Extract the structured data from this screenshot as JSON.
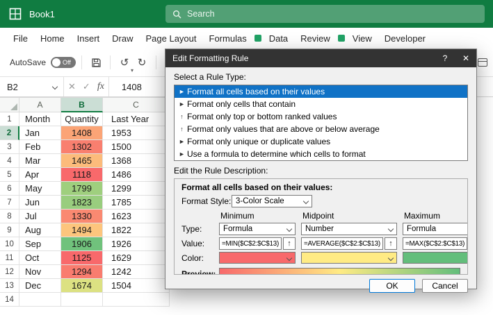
{
  "titlebar": {
    "title": "Book1",
    "search_placeholder": "Search"
  },
  "menu": {
    "items": [
      "File",
      "Home",
      "Insert",
      "Draw",
      "Page Layout",
      "Formulas",
      "Data",
      "Review",
      "View",
      "Developer"
    ]
  },
  "toolbar": {
    "autosave_label": "AutoSave",
    "autosave_state": "Off",
    "undo_glyph": "↺",
    "redo_glyph": "↻"
  },
  "formula_bar": {
    "name_box": "B2",
    "cancel_glyph": "✕",
    "enter_glyph": "✓",
    "fx_label": "fx",
    "value": "1408"
  },
  "grid": {
    "col_headers": [
      "A",
      "B",
      "C"
    ],
    "rows": [
      {
        "n": 1,
        "a": "Month",
        "b": "Quantity",
        "c": "Last Year"
      },
      {
        "n": 2,
        "a": "Jan",
        "b": "1408",
        "c": "1953",
        "b_color": "#FBA476"
      },
      {
        "n": 3,
        "a": "Feb",
        "b": "1302",
        "c": "1500",
        "b_color": "#F97F6F"
      },
      {
        "n": 4,
        "a": "Mar",
        "b": "1465",
        "c": "1368",
        "b_color": "#FCBB7B"
      },
      {
        "n": 5,
        "a": "Apr",
        "b": "1118",
        "c": "1486",
        "b_color": "#F8696B"
      },
      {
        "n": 6,
        "a": "May",
        "b": "1799",
        "c": "1299",
        "b_color": "#9FCF7E"
      },
      {
        "n": 7,
        "a": "Jun",
        "b": "1823",
        "c": "1785",
        "b_color": "#99CD7E"
      },
      {
        "n": 8,
        "a": "Jul",
        "b": "1330",
        "c": "1623",
        "b_color": "#FA8971"
      },
      {
        "n": 9,
        "a": "Aug",
        "b": "1494",
        "c": "1822",
        "b_color": "#FDC57D"
      },
      {
        "n": 10,
        "a": "Sep",
        "b": "1906",
        "c": "1926",
        "b_color": "#70C27C"
      },
      {
        "n": 11,
        "a": "Oct",
        "b": "1125",
        "c": "1629",
        "b_color": "#F8696B"
      },
      {
        "n": 12,
        "a": "Nov",
        "b": "1294",
        "c": "1242",
        "b_color": "#F97C6F"
      },
      {
        "n": 13,
        "a": "Dec",
        "b": "1674",
        "c": "1504",
        "b_color": "#DCE182"
      },
      {
        "n": 14,
        "a": "",
        "b": "",
        "c": ""
      }
    ]
  },
  "dialog": {
    "title": "Edit Formatting Rule",
    "help_glyph": "?",
    "close_glyph": "✕",
    "select_rule_label": "Select a Rule Type:",
    "rule_types": [
      {
        "icon": "►",
        "label": "Format all cells based on their values"
      },
      {
        "icon": "►",
        "label": "Format only cells that contain"
      },
      {
        "icon": "↑",
        "label": "Format only top or bottom ranked values"
      },
      {
        "icon": "↑",
        "label": "Format only values that are above or below average"
      },
      {
        "icon": "►",
        "label": "Format only unique or duplicate values"
      },
      {
        "icon": "►",
        "label": "Use a formula to determine which cells to format"
      }
    ],
    "edit_desc_label": "Edit the Rule Description:",
    "group_title": "Format all cells based on their values:",
    "format_style_label": "Format Style:",
    "format_style_value": "3-Color Scale",
    "col_headers": [
      "Minimum",
      "Midpoint",
      "Maximum"
    ],
    "type_label": "Type:",
    "value_label": "Value:",
    "color_label": "Color:",
    "types": [
      "Formula",
      "Number",
      "Formula"
    ],
    "values": [
      "=MIN($C$2:$C$13)",
      "=AVERAGE($C$2:$C$13)",
      "=MAX($C$2:$C$13)"
    ],
    "range_button_glyph": "↑",
    "colors": [
      "#F8696B",
      "#FFEB84",
      "#63BE7B"
    ],
    "preview_label": "Preview:",
    "ok_label": "OK",
    "cancel_label": "Cancel"
  }
}
